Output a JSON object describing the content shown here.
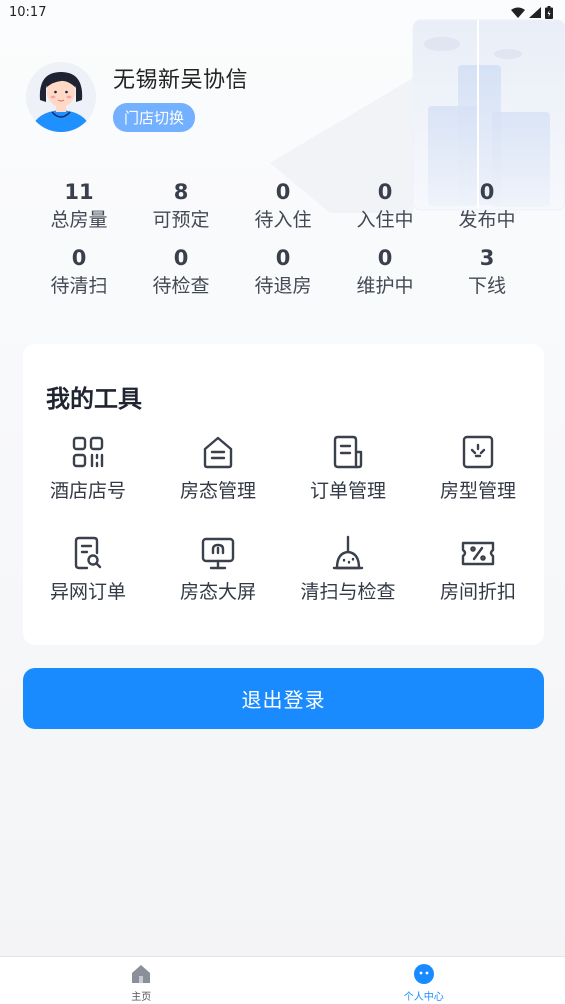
{
  "status_bar": {
    "time": "10:17"
  },
  "profile": {
    "hotel_name": "无锡新吴协信",
    "switch_label": "门店切换"
  },
  "stats": [
    {
      "value": "11",
      "label": "总房量"
    },
    {
      "value": "8",
      "label": "可预定"
    },
    {
      "value": "0",
      "label": "待入住"
    },
    {
      "value": "0",
      "label": "入住中"
    },
    {
      "value": "0",
      "label": "发布中"
    },
    {
      "value": "0",
      "label": "待清扫"
    },
    {
      "value": "0",
      "label": "待检查"
    },
    {
      "value": "0",
      "label": "待退房"
    },
    {
      "value": "0",
      "label": "维护中"
    },
    {
      "value": "3",
      "label": "下线"
    }
  ],
  "tools": {
    "title": "我的工具",
    "items": [
      {
        "label": "酒店店号",
        "icon": "qr-code-icon"
      },
      {
        "label": "房态管理",
        "icon": "house-icon"
      },
      {
        "label": "订单管理",
        "icon": "document-icon"
      },
      {
        "label": "房型管理",
        "icon": "room-type-icon"
      },
      {
        "label": "异网订单",
        "icon": "search-document-icon"
      },
      {
        "label": "房态大屏",
        "icon": "monitor-icon"
      },
      {
        "label": "清扫与检查",
        "icon": "broom-icon"
      },
      {
        "label": "房间折扣",
        "icon": "discount-ticket-icon"
      }
    ]
  },
  "logout_label": "退出登录",
  "tab_bar": {
    "items": [
      {
        "label": "主页",
        "icon": "home-icon",
        "active": false
      },
      {
        "label": "个人中心",
        "icon": "profile-icon",
        "active": true
      }
    ]
  },
  "colors": {
    "accent": "#1a8bff",
    "switch_bg": "#73b0ff"
  }
}
